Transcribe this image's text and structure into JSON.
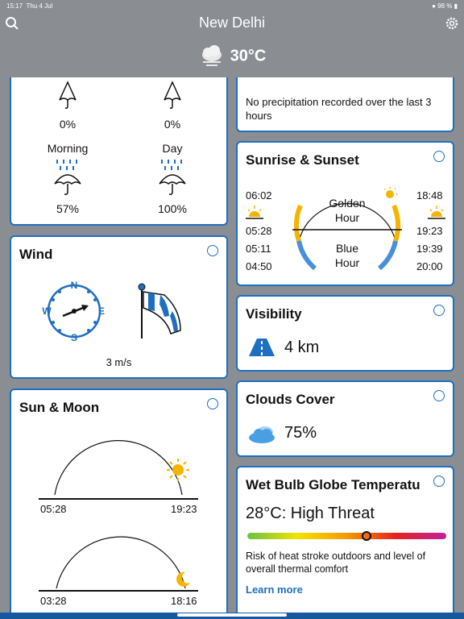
{
  "status": {
    "time": "15:17",
    "date": "Thu 4 Jul",
    "battery": "98 %"
  },
  "header": {
    "city": "New Delhi",
    "temperature": "30°C",
    "condition_icon": "cloudy-icon"
  },
  "precip": {
    "top_left_value": "0%",
    "top_right_value": "0%",
    "morning_label": "Morning",
    "day_label": "Day",
    "morning_value": "57%",
    "day_value": "100%"
  },
  "precip_note": {
    "text": "No precipitation recorded over the last 3 hours"
  },
  "wind": {
    "title": "Wind",
    "speed": "3 m/s",
    "compass": {
      "n": "N",
      "e": "E",
      "s": "S",
      "w": "W"
    }
  },
  "sunmoon": {
    "title": "Sun & Moon",
    "sunrise": "05:28",
    "sunset": "19:23",
    "moonrise": "03:28",
    "moonset": "18:16"
  },
  "sunrise_sunset": {
    "title": "Sunrise & Sunset",
    "golden_label_1": "Golden",
    "golden_label_2": "Hour",
    "blue_label_1": "Blue",
    "blue_label_2": "Hour",
    "left_times": [
      "06:02",
      "05:28",
      "05:11",
      "04:50"
    ],
    "right_times": [
      "18:48",
      "19:23",
      "19:39",
      "20:00"
    ]
  },
  "visibility": {
    "title": "Visibility",
    "value": "4 km"
  },
  "clouds": {
    "title": "Clouds Cover",
    "value": "75%"
  },
  "wbgt": {
    "title": "Wet Bulb Globe Temperatu",
    "value": "28°C: High Threat",
    "description": "Risk of heat stroke outdoors and level of overall thermal comfort",
    "link": "Learn more",
    "indicator_fraction": 0.6
  },
  "colors": {
    "accent": "#1f6fc0",
    "background": "#8a8d92",
    "sun": "#f5b400",
    "blue_hour": "#4a90d9"
  }
}
